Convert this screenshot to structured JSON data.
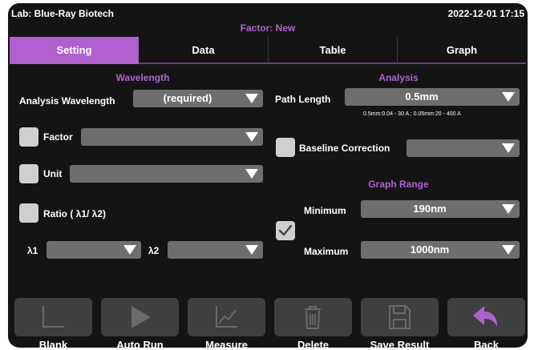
{
  "header": {
    "lab": "Lab: Blue-Ray Biotech",
    "datetime": "2022-12-01 17:15",
    "factor_title": "Factor: New"
  },
  "tabs": [
    {
      "label": "Setting",
      "active": true
    },
    {
      "label": "Data",
      "active": false
    },
    {
      "label": "Table",
      "active": false
    },
    {
      "label": "Graph",
      "active": false
    }
  ],
  "wavelength": {
    "title": "Wavelength",
    "analysis_label": "Analysis Wavelength",
    "analysis_value": "(required)",
    "factor_label": "Factor",
    "factor_checked": false,
    "factor_value": "",
    "unit_label": "Unit",
    "unit_checked": false,
    "unit_value": "",
    "ratio_label": "Ratio ( λ1/ λ2)",
    "ratio_checked": false,
    "l1_label": "λ1",
    "l1_value": "",
    "l2_label": "λ2",
    "l2_value": ""
  },
  "analysis": {
    "title": "Analysis",
    "path_label": "Path Length",
    "path_value": "0.5mm",
    "path_note": "0.5mm:0.04 - 30 A ; 0.05mm:20 - 400 A",
    "baseline_label": "Baseline Correction",
    "baseline_checked": false,
    "baseline_value": ""
  },
  "graph_range": {
    "title": "Graph Range",
    "checked": true,
    "min_label": "Minimum",
    "min_value": "190nm",
    "max_label": "Maximum",
    "max_value": "1000nm"
  },
  "toolbar": [
    {
      "label": "Blank",
      "icon": "blank-axis-icon"
    },
    {
      "label": "Auto Run",
      "icon": "play-icon"
    },
    {
      "label": "Measure",
      "icon": "line-chart-icon"
    },
    {
      "label": "Delete",
      "icon": "trash-icon"
    },
    {
      "label": "Save Result",
      "icon": "save-icon"
    },
    {
      "label": "Back",
      "icon": "back-arrow-icon"
    }
  ],
  "colors": {
    "accent": "#b060cf",
    "background": "#141414",
    "control": "#6e6e6e",
    "button": "#3f3f3f"
  }
}
